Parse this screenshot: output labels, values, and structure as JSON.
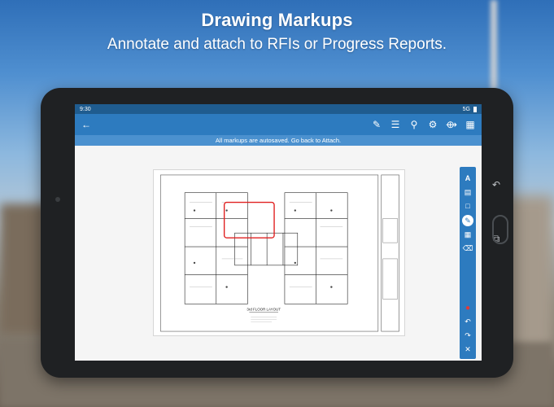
{
  "headline": {
    "title": "Drawing Markups",
    "subtitle": "Annotate and attach to RFIs or Progress Reports."
  },
  "status_bar": {
    "time": "9:30",
    "network": "5G"
  },
  "app_bar": {
    "back_icon": "arrow-left-icon",
    "actions": [
      "pencil-icon",
      "list-icon",
      "search-icon",
      "gear-icon",
      "share-icon",
      "grid-icon"
    ]
  },
  "notice": {
    "text": "All markups are autosaved. Go back to Attach."
  },
  "drawing": {
    "caption": "3rd FLOOR LAYOUT",
    "markup_color": "#e02020"
  },
  "markup_toolbar": {
    "tools": [
      "text-icon",
      "note-icon",
      "rectangle-icon",
      "pen-icon",
      "image-icon",
      "eraser-icon"
    ],
    "active_tool": "pen-icon",
    "actions": [
      "record-icon",
      "undo-icon",
      "redo-icon",
      "close-icon"
    ]
  },
  "colors": {
    "accent": "#2d7bbf",
    "status_bar": "#1f5c8f",
    "notice": "#4b91cf"
  }
}
